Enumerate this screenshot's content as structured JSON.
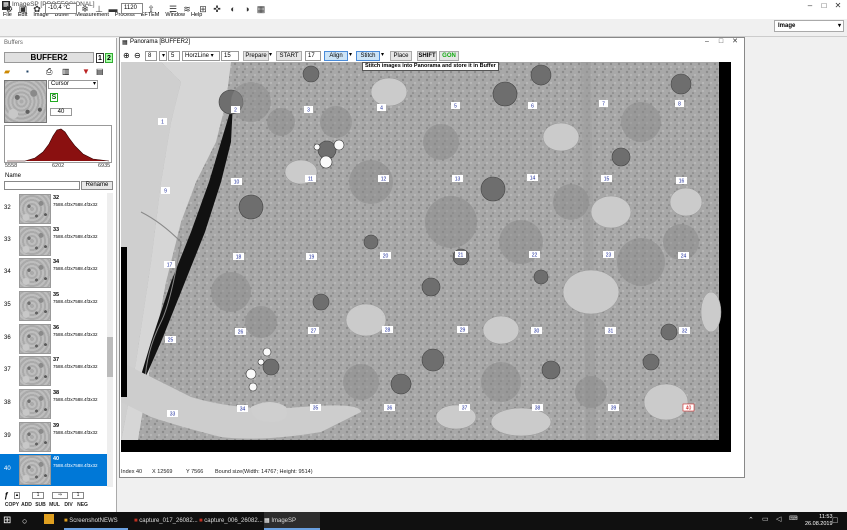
{
  "app": {
    "title": "ImageSP [PROFESSIONAL]",
    "icon": "imagesp-icon"
  },
  "menu": [
    "File",
    "Edit",
    "Image",
    "Buffer",
    "Measurement",
    "Process",
    "EFTEM",
    "Window",
    "Help"
  ],
  "toolbar": {
    "zoom_value": "-10,4 °C",
    "percent_value": "1120",
    "view_select": "Image"
  },
  "buffers": {
    "panel_title": "Buffers",
    "buffer_name": "BUFFER2",
    "badge1": "1",
    "badge2": "2",
    "tool_select": "Cursor",
    "level_value": "40",
    "hist_min": "5558",
    "hist_mid": "6202",
    "hist_max": "6935",
    "name_label": "Name",
    "rename_label": "Rename",
    "items": [
      {
        "index": "32",
        "label": "32",
        "sub": "7588.4f3x7588.4f3x32"
      },
      {
        "index": "33",
        "label": "33",
        "sub": "7588.4f3x7588.4f3x32"
      },
      {
        "index": "34",
        "label": "34",
        "sub": "7588.4f3x7588.4f3x32"
      },
      {
        "index": "35",
        "label": "35",
        "sub": "7588.4f3x7588.4f3x32"
      },
      {
        "index": "36",
        "label": "36",
        "sub": "7588.4f3x7588.4f3x32"
      },
      {
        "index": "37",
        "label": "37",
        "sub": "7588.4f3x7588.4f3x32"
      },
      {
        "index": "38",
        "label": "38",
        "sub": "7588.4f3x7588.4f3x32"
      },
      {
        "index": "39",
        "label": "39",
        "sub": "7588.4f3x7588.4f3x32"
      },
      {
        "index": "40",
        "label": "40",
        "sub": "7588.4f3x7588.4f3x32"
      }
    ],
    "bottom_buttons": [
      "COPY",
      "ADD",
      "SUB",
      "MUL",
      "DIV",
      "NEG"
    ],
    "stepper_value": "1"
  },
  "panorama": {
    "title": "Panorama [BUFFER2]",
    "toolbar": {
      "field_a": "8",
      "field_b": "5",
      "direction": "HorzLine",
      "count": "15",
      "prepare": "Prepare",
      "start": "START",
      "start_num": "17",
      "align": "Align",
      "stitch": "Stitch",
      "place": "Place",
      "shift": "SHIFT",
      "gon": "GON"
    },
    "tooltip": "Stitch images into Panorama and store it in Buffer",
    "tiles": [
      "1",
      "2",
      "3",
      "4",
      "5",
      "6",
      "7",
      "8",
      "9",
      "10",
      "11",
      "12",
      "13",
      "14",
      "15",
      "16",
      "17",
      "18",
      "19",
      "20",
      "21",
      "22",
      "23",
      "24",
      "25",
      "26",
      "27",
      "28",
      "29",
      "30",
      "31",
      "32",
      "33",
      "34",
      "35",
      "36",
      "37",
      "38",
      "39",
      "40"
    ],
    "status": {
      "index": "Index 40",
      "x": "X 12569",
      "y": "Y 7566",
      "bound": "Bound size(Width: 14767; Height: 9514)"
    }
  },
  "taskbar": {
    "items": [
      "ScreenshotNEWS",
      "capture_017_26082...",
      "capture_006_26082...",
      "ImageSP"
    ],
    "time": "11:53",
    "date": "26.08.2019"
  }
}
